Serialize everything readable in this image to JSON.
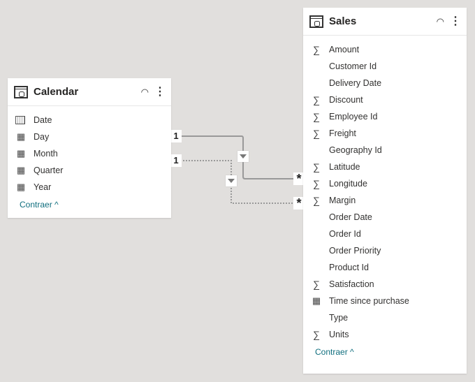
{
  "calendar": {
    "title": "Calendar",
    "collapse_label": "Contraer ^",
    "fields": [
      {
        "name": "Date",
        "icon": "calendar-icon"
      },
      {
        "name": "Day",
        "icon": "hierarchy-icon"
      },
      {
        "name": "Month",
        "icon": "hierarchy-icon"
      },
      {
        "name": "Quarter",
        "icon": "hierarchy-icon"
      },
      {
        "name": "Year",
        "icon": "hierarchy-icon"
      }
    ]
  },
  "sales": {
    "title": "Sales",
    "collapse_label": "Contraer ^",
    "fields": [
      {
        "name": "Amount",
        "icon": "sigma-icon"
      },
      {
        "name": "Customer Id",
        "icon": ""
      },
      {
        "name": "Delivery Date",
        "icon": ""
      },
      {
        "name": "Discount",
        "icon": "sigma-icon"
      },
      {
        "name": "Employee Id",
        "icon": "sigma-icon"
      },
      {
        "name": "Freight",
        "icon": "sigma-icon"
      },
      {
        "name": "Geography Id",
        "icon": ""
      },
      {
        "name": "Latitude",
        "icon": "sigma-icon"
      },
      {
        "name": "Longitude",
        "icon": "sigma-icon"
      },
      {
        "name": "Margin",
        "icon": "sigma-icon"
      },
      {
        "name": "Order Date",
        "icon": ""
      },
      {
        "name": "Order Id",
        "icon": ""
      },
      {
        "name": "Order Priority",
        "icon": ""
      },
      {
        "name": "Product Id",
        "icon": ""
      },
      {
        "name": "Satisfaction",
        "icon": "sigma-icon"
      },
      {
        "name": "Time since purchase",
        "icon": "hierarchy-icon"
      },
      {
        "name": "Type",
        "icon": ""
      },
      {
        "name": "Units",
        "icon": "sigma-icon"
      }
    ]
  },
  "relationships": [
    {
      "from_card": "1",
      "to_card": "*",
      "style": "active"
    },
    {
      "from_card": "1",
      "to_card": "*",
      "style": "inactive"
    }
  ]
}
